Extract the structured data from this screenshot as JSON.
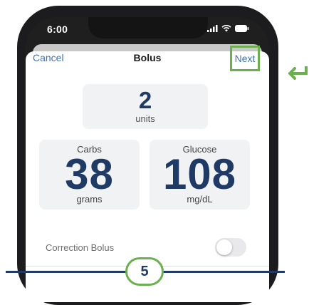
{
  "status_bar": {
    "time": "6:00"
  },
  "nav": {
    "cancel": "Cancel",
    "title": "Bolus",
    "next": "Next"
  },
  "units": {
    "value": "2",
    "label": "units"
  },
  "carbs": {
    "caption": "Carbs",
    "value": "38",
    "unit": "grams"
  },
  "glucose": {
    "caption": "Glucose",
    "value": "108",
    "unit": "mg/dL"
  },
  "correction": {
    "label": "Correction Bolus",
    "enabled": false
  },
  "step": {
    "number": "5"
  },
  "colors": {
    "accent_green": "#6ab04c",
    "link_blue": "#3f72b6",
    "value_navy": "#1f3a64"
  }
}
